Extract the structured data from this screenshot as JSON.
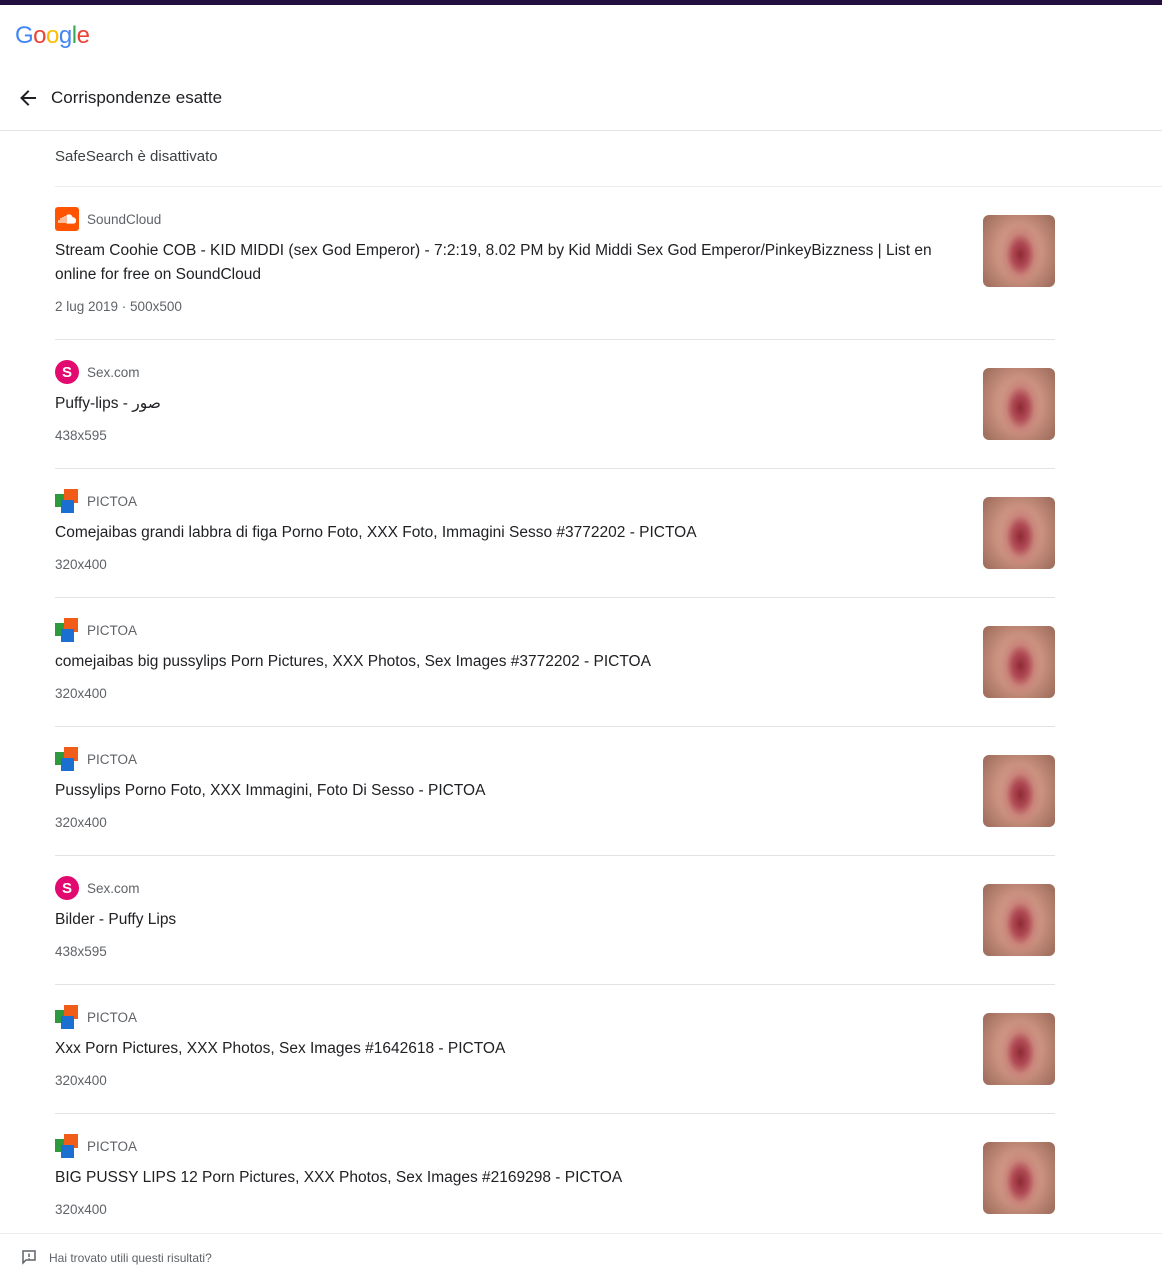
{
  "logo": "Google",
  "header": {
    "title": "Corrispondenze esatte"
  },
  "safesearch": "SafeSearch è disattivato",
  "colors": {
    "topbar": "#24103e",
    "soundcloud": "#ff5500",
    "sexcom": "#e20a6f"
  },
  "results": [
    {
      "source": "SoundCloud",
      "favicon": "soundcloud-icon",
      "title": "Stream Coohie COB - KID MIDDI (sex God Emperor) - 7:2:19, 8.02 PM by Kid Middi Sex God Emperor/PinkeyBizzness | List en online for free on SoundCloud",
      "meta": "2 lug 2019 · 500x500"
    },
    {
      "source": "Sex.com",
      "favicon": "sexcom-icon",
      "title": "Puffy-lips - صور",
      "meta": "438x595"
    },
    {
      "source": "PICTOA",
      "favicon": "pictoa-icon",
      "title": "Comejaibas grandi labbra di figa Porno Foto, XXX Foto, Immagini Sesso #3772202 - PICTOA",
      "meta": "320x400"
    },
    {
      "source": "PICTOA",
      "favicon": "pictoa-icon",
      "title": "comejaibas big pussylips Porn Pictures, XXX Photos, Sex Images #3772202 - PICTOA",
      "meta": "320x400"
    },
    {
      "source": "PICTOA",
      "favicon": "pictoa-icon",
      "title": "Pussylips Porno Foto, XXX Immagini, Foto Di Sesso - PICTOA",
      "meta": "320x400"
    },
    {
      "source": "Sex.com",
      "favicon": "sexcom-icon",
      "title": "Bilder - Puffy Lips",
      "meta": "438x595"
    },
    {
      "source": "PICTOA",
      "favicon": "pictoa-icon",
      "title": "Xxx Porn Pictures, XXX Photos, Sex Images #1642618 - PICTOA",
      "meta": "320x400"
    },
    {
      "source": "PICTOA",
      "favicon": "pictoa-icon",
      "title": "BIG PUSSY LIPS 12 Porn Pictures, XXX Photos, Sex Images #2169298 - PICTOA",
      "meta": "320x400"
    }
  ],
  "feedback": {
    "text": "Hai trovato utili questi risultati?"
  }
}
